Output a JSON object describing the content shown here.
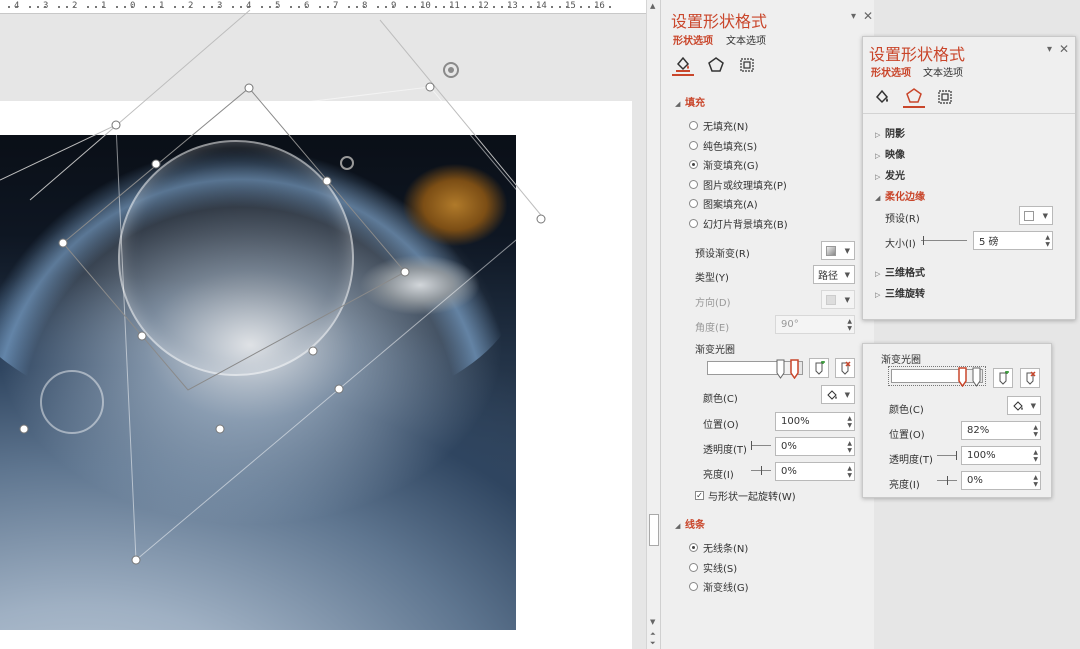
{
  "ruler": {
    "labels": [
      "4",
      "3",
      "2",
      "1",
      "0",
      "1",
      "2",
      "3",
      "4",
      "5",
      "6",
      "7",
      "8",
      "9",
      "10",
      "11",
      "12",
      "13",
      "14",
      "15",
      "16"
    ]
  },
  "main_panel": {
    "title": "设置形状格式",
    "tabs": [
      "形状选项",
      "文本选项"
    ],
    "icon_tabs": [
      "fill-line-icon",
      "effects-pentagon-icon",
      "size-properties-icon"
    ],
    "fill": {
      "heading": "填充",
      "options": [
        {
          "label": "无填充(N)",
          "selected": false
        },
        {
          "label": "纯色填充(S)",
          "selected": false
        },
        {
          "label": "渐变填充(G)",
          "selected": true
        },
        {
          "label": "图片或纹理填充(P)",
          "selected": false
        },
        {
          "label": "图案填充(A)",
          "selected": false
        },
        {
          "label": "幻灯片背景填充(B)",
          "selected": false
        }
      ],
      "preset_label": "预设渐变(R)",
      "type_label": "类型(Y)",
      "type_value": "路径",
      "direction_label": "方向(D)",
      "angle_label": "角度(E)",
      "angle_value": "90°",
      "stops_label": "渐变光圈",
      "color_label": "颜色(C)",
      "position_label": "位置(O)",
      "position_value": "100%",
      "transparency_label": "透明度(T)",
      "transparency_value": "0%",
      "brightness_label": "亮度(I)",
      "brightness_value": "0%",
      "rotate_label": "与形状一起旋转(W)",
      "rotate_checked": true
    },
    "line": {
      "heading": "线条",
      "options": [
        {
          "label": "无线条(N)",
          "selected": true
        },
        {
          "label": "实线(S)",
          "selected": false
        },
        {
          "label": "渐变线(G)",
          "selected": false
        }
      ]
    }
  },
  "shape_panel": {
    "title": "设置形状格式",
    "tabs": [
      "形状选项",
      "文本选项"
    ],
    "sections": [
      "阴影",
      "映像",
      "发光",
      "柔化边缘",
      "三维格式",
      "三维旋转"
    ],
    "soft_edges": {
      "preset_label": "预设(R)",
      "size_label": "大小(I)",
      "size_value": "5 磅"
    }
  },
  "stops_panel": {
    "title": "渐变光圈",
    "color_label": "颜色(C)",
    "position_label": "位置(O)",
    "position_value": "82%",
    "transparency_label": "透明度(T)",
    "transparency_value": "100%",
    "brightness_label": "亮度(I)",
    "brightness_value": "0%"
  },
  "colors": {
    "accent": "#c9462b",
    "panel_bg": "#efefef"
  }
}
